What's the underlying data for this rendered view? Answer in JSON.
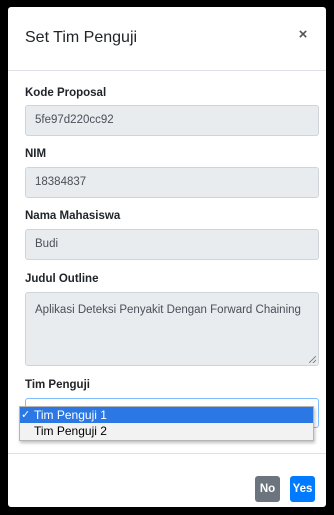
{
  "modal": {
    "title": "Set Tim Penguji",
    "close_label": "×"
  },
  "form": {
    "kode_proposal": {
      "label": "Kode Proposal",
      "value": "5fe97d220cc92"
    },
    "nim": {
      "label": "NIM",
      "value": "18384837"
    },
    "nama_mahasiswa": {
      "label": "Nama Mahasiswa",
      "value": "Budi"
    },
    "judul_outline": {
      "label": "Judul Outline",
      "value": "Aplikasi Deteksi Penyakit Dengan Forward Chaining"
    },
    "tim_penguji": {
      "label": "Tim Penguji",
      "caret_icon": "chevron-down-icon",
      "options": [
        {
          "label": "Tim Penguji 1",
          "check": "✓",
          "selected": true
        },
        {
          "label": "Tim Penguji 2",
          "check": "",
          "selected": false
        }
      ]
    }
  },
  "footer": {
    "no_label": "No",
    "yes_label": "Yes"
  },
  "colors": {
    "primary": "#007bff",
    "secondary": "#6c757d",
    "dropdown_highlight": "#2b78e4"
  }
}
